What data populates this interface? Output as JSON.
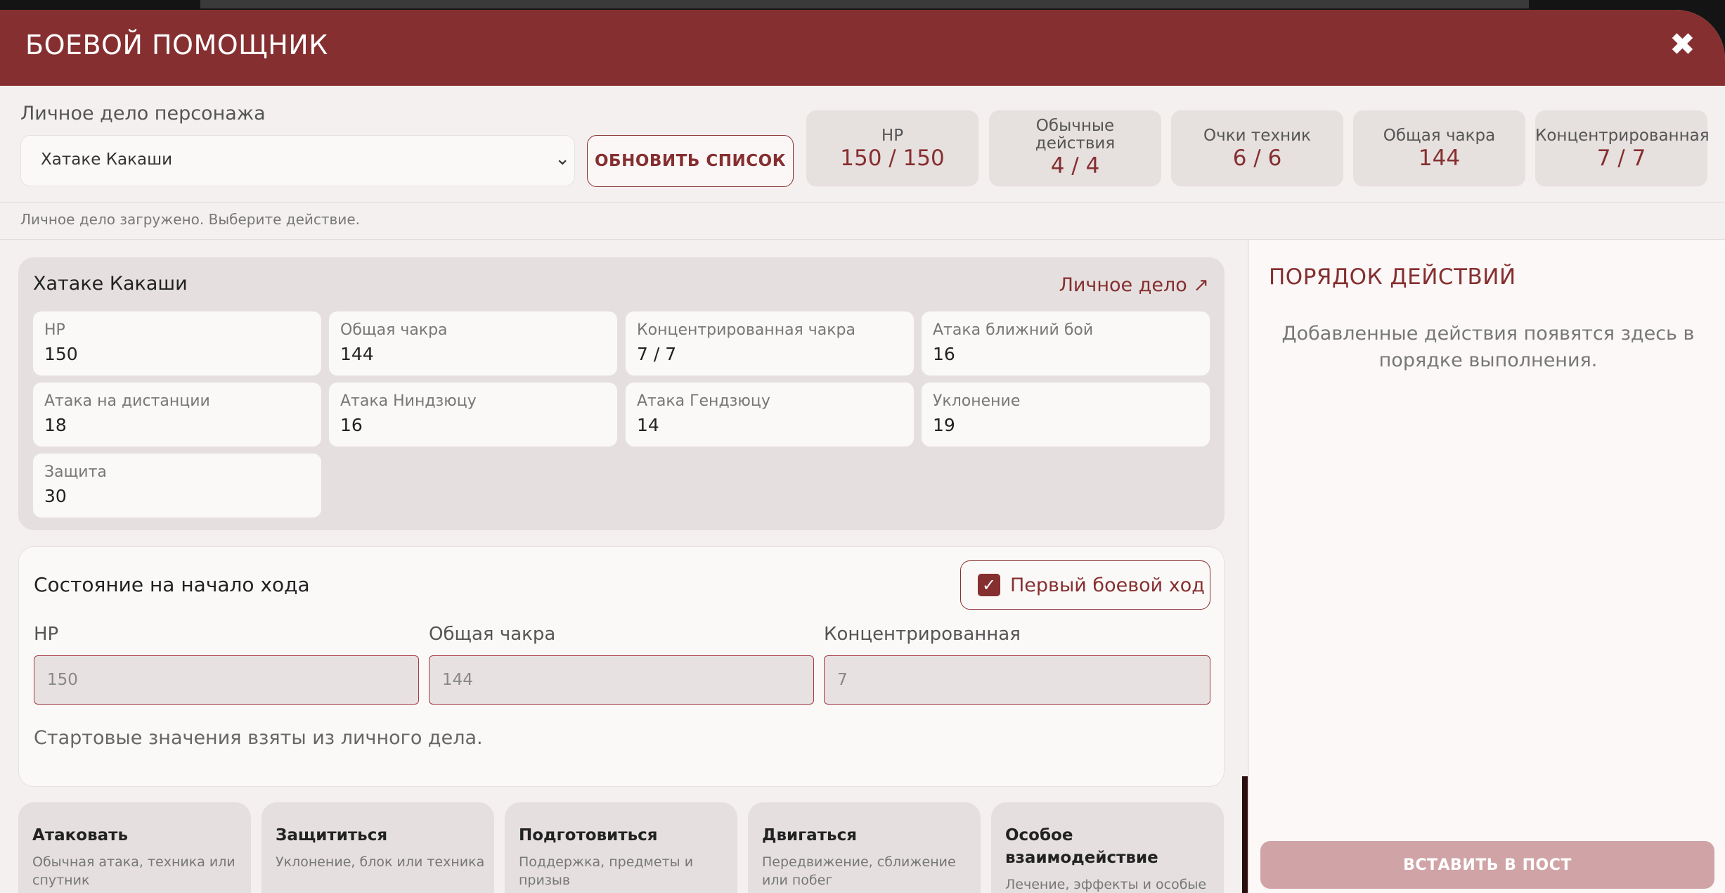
{
  "header": {
    "title": "БОЕВОЙ ПОМОЩНИК",
    "close_icon": "close-icon"
  },
  "top": {
    "label": "Личное дело персонажа",
    "select_value": "Хатаке Какаши",
    "refresh_label": "ОБНОВИТЬ СПИСОК",
    "status": "Личное дело загружено. Выберите действие."
  },
  "stats": [
    {
      "label": "HP",
      "value": "150 / 150"
    },
    {
      "label": "Обычные действия",
      "value": "4 / 4"
    },
    {
      "label": "Очки техник",
      "value": "6 / 6"
    },
    {
      "label": "Общая чакра",
      "value": "144"
    },
    {
      "label": "Концентрированная",
      "value": "7 / 7"
    }
  ],
  "profile": {
    "name": "Хатаке Какаши",
    "link": "Личное дело ↗",
    "fields": [
      {
        "label": "HP",
        "value": "150"
      },
      {
        "label": "Общая чакра",
        "value": "144"
      },
      {
        "label": "Концентрированная чакра",
        "value": "7 / 7"
      },
      {
        "label": "Атака ближний бой",
        "value": "16"
      },
      {
        "label": "Атака на дистанции",
        "value": "18"
      },
      {
        "label": "Атака Ниндзюцу",
        "value": "16"
      },
      {
        "label": "Атака Гендзюцу",
        "value": "14"
      },
      {
        "label": "Уклонение",
        "value": "19"
      },
      {
        "label": "Защита",
        "value": "30"
      }
    ]
  },
  "turn": {
    "title": "Состояние на начало хода",
    "first_turn_label": "Первый боевой ход",
    "first_turn_checked": true,
    "inputs": [
      {
        "label": "HP",
        "placeholder": "150"
      },
      {
        "label": "Общая чакра",
        "placeholder": "144"
      },
      {
        "label": "Концентрированная",
        "placeholder": "7"
      }
    ],
    "note": "Стартовые значения взяты из личного дела."
  },
  "actions": [
    {
      "name": "Атаковать",
      "desc": "Обычная атака, техника или спутник"
    },
    {
      "name": "Защититься",
      "desc": "Уклонение, блок или техника"
    },
    {
      "name": "Подготовиться",
      "desc": "Поддержка, предметы и призыв"
    },
    {
      "name": "Двигаться",
      "desc": "Передвижение, сближение или побег"
    },
    {
      "name": "Особое взаимодействие",
      "desc": "Лечение, эффекты и особые ходы"
    }
  ],
  "order": {
    "title": "ПОРЯДОК ДЕЙСТВИЙ",
    "empty": "Добавленные действия появятся здесь в порядке выполнения.",
    "insert_label": "ВСТАВИТЬ В ПОСТ"
  },
  "colors": {
    "accent": "#862f30",
    "insert_disabled": "#d0a4a6"
  }
}
